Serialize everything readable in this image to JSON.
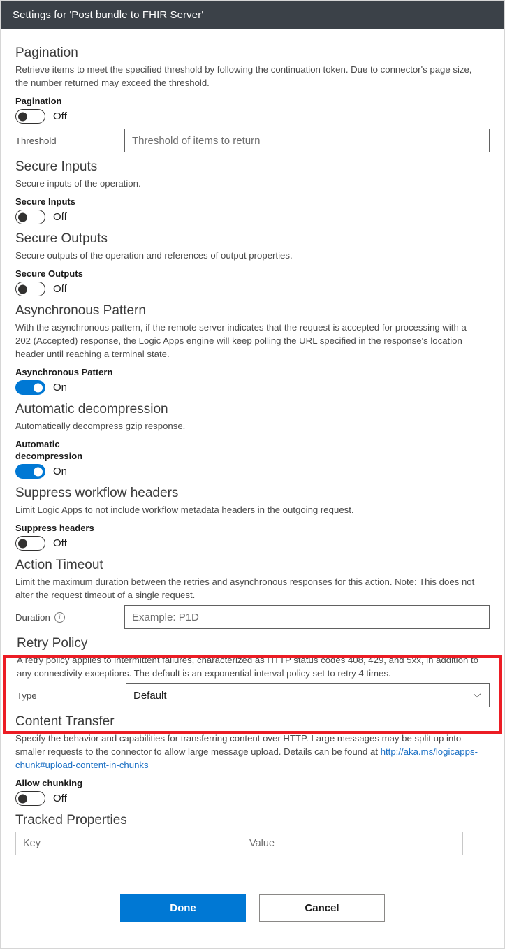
{
  "window": {
    "title": "Settings for 'Post bundle to FHIR Server'"
  },
  "colors": {
    "titlebar": "#3b4148",
    "accent": "#0078d4",
    "highlight": "#ec1c24",
    "link": "#1a6fc4"
  },
  "sections": {
    "pagination": {
      "title": "Pagination",
      "description": "Retrieve items to meet the specified threshold by following the continuation token. Due to connector's page size, the number returned may exceed the threshold.",
      "toggle_label": "Pagination",
      "toggle_state": "Off",
      "threshold_label": "Threshold",
      "threshold_placeholder": "Threshold of items to return"
    },
    "secure_inputs": {
      "title": "Secure Inputs",
      "description": "Secure inputs of the operation.",
      "toggle_label": "Secure Inputs",
      "toggle_state": "Off"
    },
    "secure_outputs": {
      "title": "Secure Outputs",
      "description": "Secure outputs of the operation and references of output properties.",
      "toggle_label": "Secure Outputs",
      "toggle_state": "Off"
    },
    "async_pattern": {
      "title": "Asynchronous Pattern",
      "description": "With the asynchronous pattern, if the remote server indicates that the request is accepted for processing with a 202 (Accepted) response, the Logic Apps engine will keep polling the URL specified in the response's location header until reaching a terminal state.",
      "toggle_label": "Asynchronous Pattern",
      "toggle_state": "On"
    },
    "auto_decompression": {
      "title": "Automatic decompression",
      "description": "Automatically decompress gzip response.",
      "toggle_label": "Automatic decompression",
      "toggle_state": "On"
    },
    "suppress_headers": {
      "title": "Suppress workflow headers",
      "description": "Limit Logic Apps to not include workflow metadata headers in the outgoing request.",
      "toggle_label": "Suppress headers",
      "toggle_state": "Off"
    },
    "action_timeout": {
      "title": "Action Timeout",
      "description": "Limit the maximum duration between the retries and asynchronous responses for this action. Note: This does not alter the request timeout of a single request.",
      "duration_label": "Duration",
      "duration_info_icon": "info-icon",
      "duration_placeholder": "Example: P1D"
    },
    "retry_policy": {
      "title": "Retry Policy",
      "description": "A retry policy applies to intermittent failures, characterized as HTTP status codes 408, 429, and 5xx, in addition to any connectivity exceptions. The default is an exponential interval policy set to retry 4 times.",
      "type_label": "Type",
      "type_value": "Default",
      "chevron_icon": "chevron-down-icon",
      "highlighted": true
    },
    "content_transfer": {
      "title": "Content Transfer",
      "description_line1": "Specify the behavior and capabilities for transferring content over HTTP. Large messages may be split up into smaller requests to the connector to allow large message upload. Details can be found at",
      "link_text": "http://aka.ms/logicapps-chunk#upload-content-in-chunks",
      "toggle_label": "Allow chunking",
      "toggle_state": "Off"
    },
    "tracked_properties": {
      "title": "Tracked Properties",
      "key_placeholder": "Key",
      "value_placeholder": "Value"
    }
  },
  "footer": {
    "done_label": "Done",
    "cancel_label": "Cancel"
  }
}
